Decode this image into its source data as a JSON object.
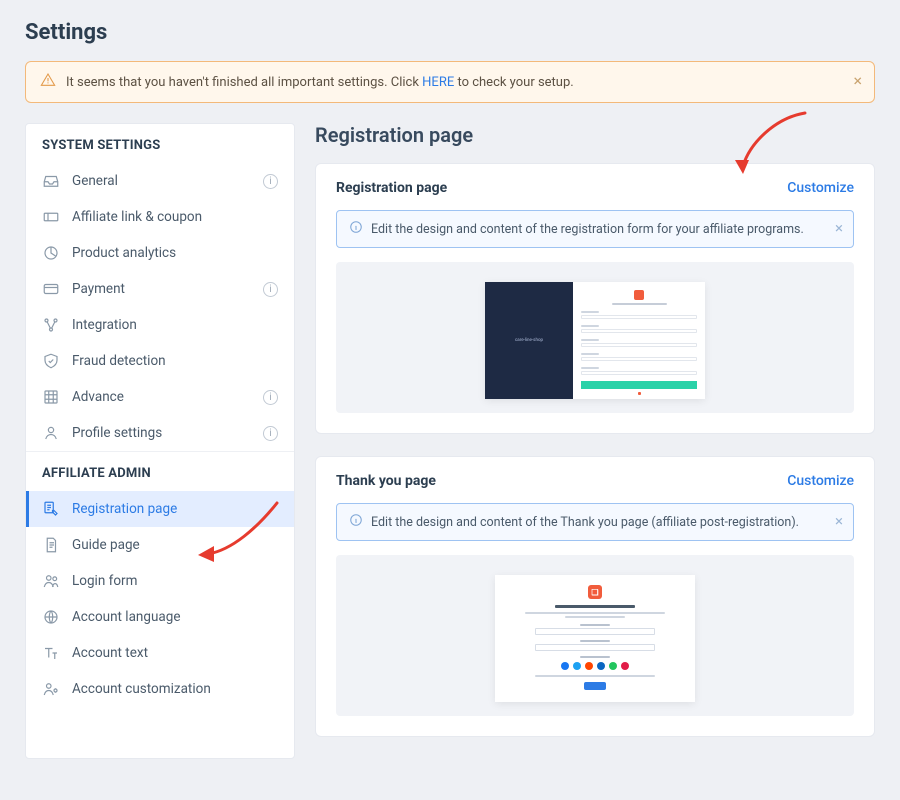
{
  "page_title": "Settings",
  "alert": {
    "text_before": "It seems that you haven't finished all important settings. Click ",
    "link": "HERE",
    "text_after": " to check your setup."
  },
  "sidebar": {
    "system_section": "SYSTEM SETTINGS",
    "admin_section": "AFFILIATE ADMIN",
    "system_items": [
      {
        "label": "General",
        "info": true
      },
      {
        "label": "Affiliate link & coupon",
        "info": false
      },
      {
        "label": "Product analytics",
        "info": false
      },
      {
        "label": "Payment",
        "info": true
      },
      {
        "label": "Integration",
        "info": false
      },
      {
        "label": "Fraud detection",
        "info": false
      },
      {
        "label": "Advance",
        "info": true
      },
      {
        "label": "Profile settings",
        "info": true
      }
    ],
    "admin_items": [
      {
        "label": "Registration page",
        "active": true
      },
      {
        "label": "Guide page"
      },
      {
        "label": "Login form"
      },
      {
        "label": "Account language"
      },
      {
        "label": "Account text"
      },
      {
        "label": "Account customization"
      }
    ]
  },
  "main": {
    "heading": "Registration page",
    "cards": {
      "registration": {
        "title": "Registration page",
        "customize": "Customize",
        "info": "Edit the design and content of the registration form for your affiliate programs."
      },
      "thankyou": {
        "title": "Thank you page",
        "customize": "Customize",
        "info": "Edit the design and content of the Thank you page (affiliate post-registration)."
      }
    }
  },
  "preview_labels": {
    "reg_side": "care-line-shop"
  },
  "social_colors": [
    "#1877f2",
    "#1da1f2",
    "#ff4500",
    "#0a66c2",
    "#22c55e",
    "#e11d48"
  ]
}
